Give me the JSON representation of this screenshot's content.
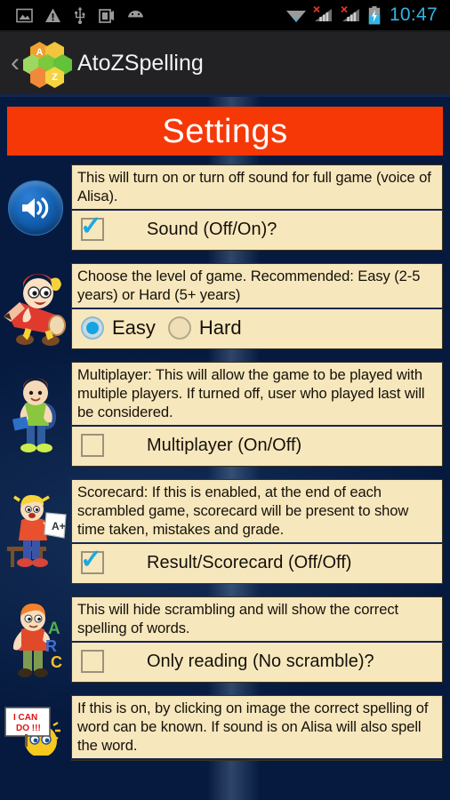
{
  "statusbar": {
    "time": "10:47",
    "icons_left": [
      "image-icon",
      "warning-icon",
      "usb-icon",
      "screenshot-icon",
      "android-icon"
    ],
    "icons_right": [
      "wifi-icon",
      "signal-sim1-icon",
      "signal-sim2-icon",
      "battery-charging-icon"
    ],
    "clock_color": "#33b5e5"
  },
  "appbar": {
    "back_label": "‹",
    "title": "AtoZSpelling",
    "logo_letters": [
      "A",
      "Z"
    ],
    "bg_color": "#222224"
  },
  "banner": {
    "title": "Settings",
    "bg_color": "#f63807",
    "text_color": "#ffffff"
  },
  "theme": {
    "card_bg": "#f7e7bd",
    "card_border": "#3a3320",
    "divider": "#13264f",
    "check_color": "#1ba8e0",
    "radio_color": "#17a3e0",
    "page_bg": "#134a90"
  },
  "settings": [
    {
      "id": "sound",
      "icon": "speaker-icon",
      "description": "This will turn on or turn off sound for full game (voice of Alisa).",
      "control_type": "checkbox",
      "label": "Sound (Off/On)?",
      "checked": true
    },
    {
      "id": "level",
      "icon": "kid-on-pencil-icon",
      "description": "Choose the level of game. Recommended: Easy (2-5 years) or Hard (5+ years)",
      "control_type": "radio",
      "options": [
        {
          "label": "Easy",
          "selected": true
        },
        {
          "label": "Hard",
          "selected": false
        }
      ]
    },
    {
      "id": "multiplayer",
      "icon": "schoolboy-icon",
      "description": "Multiplayer: This will allow the game to be played with multiple players. If turned off, user who played last will be considered.",
      "control_type": "checkbox",
      "label": "Multiplayer (On/Off)",
      "checked": false
    },
    {
      "id": "scorecard",
      "icon": "student-with-grade-icon",
      "description": "Scorecard: If this is enabled, at the end of each scrambled game, scorecard will be present to show time taken, mistakes and grade.",
      "control_type": "checkbox",
      "label": "Result/Scorecard (Off/Off)",
      "checked": true
    },
    {
      "id": "only-reading",
      "icon": "kid-with-letters-icon",
      "description": "This will hide scrambling and will show the correct spelling of words.",
      "control_type": "checkbox",
      "label": "Only reading (No scramble)?",
      "checked": false
    },
    {
      "id": "image-spell",
      "icon": "i-can-do-sign-icon",
      "description": "If this is on, by clicking on image the correct spelling of word can be known. If sound is on Alisa will also spell the word.",
      "control_type": "none",
      "partial": true
    }
  ]
}
